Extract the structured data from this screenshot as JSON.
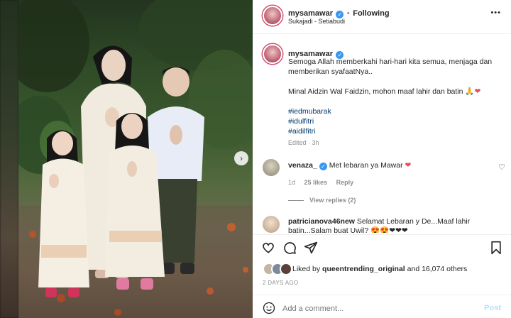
{
  "post": {
    "username": "mysamawar",
    "follow_status": "Following",
    "location": "Sukajadi - Setiabudi",
    "more": "•••"
  },
  "caption": {
    "username": "mysamawar",
    "line1": "Semoga Allah memberkahi hari-hari kita semua, menjaga dan",
    "line2": "memberikan syafaatNya..",
    "line3": "Minal Aidzin Wal Faidzin, mohon maaf lahir dan batin",
    "emoji_pray": "🙏",
    "emoji_heart": "❤",
    "hashtags": [
      "#iedmubarak",
      "#idulfitri",
      "#aidilfitri"
    ],
    "edited": "Edited · 3h"
  },
  "comments": [
    {
      "username": "venaza_",
      "text": "Met lebaran ya Mawar",
      "emoji": "❤",
      "age": "1d",
      "likes": "25 likes",
      "reply": "Reply",
      "view_replies": "View replies (2)"
    },
    {
      "username": "patricianova46new",
      "text_line1": "Selamat Lebaran y De...Maaf lahir",
      "text_line2": "batin...Salam buat Uwil?",
      "emojis": "😍😍❤❤❤"
    }
  ],
  "actions": {
    "liked_by_prefix": "Liked by",
    "liked_by_user": "queentrending_original",
    "liked_by_suffix": "and 16,074 others",
    "date": "2 DAYS AGO"
  },
  "composer": {
    "placeholder": "Add a comment...",
    "post_label": "Post"
  },
  "icons": {
    "carousel_next": "›",
    "bookmark": "bookmark-icon"
  },
  "colors": {
    "accent_link": "#00376b",
    "verified_blue": "#3897f0",
    "heart_red": "#ed4956",
    "post_button": "#b2dffc"
  }
}
